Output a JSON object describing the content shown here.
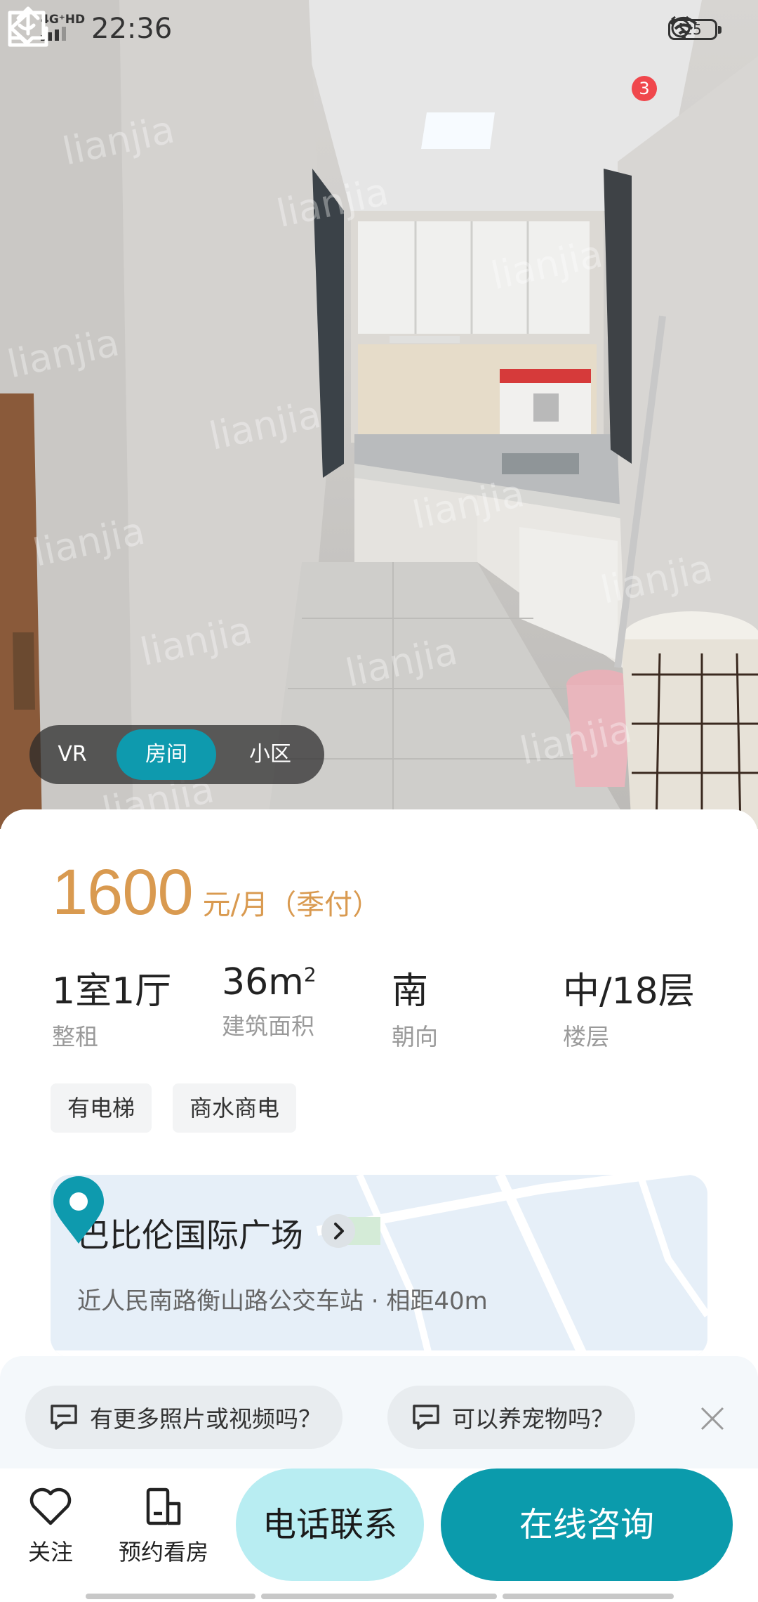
{
  "status_bar": {
    "network": "4G⁺HD",
    "time": "22:36",
    "battery": "25"
  },
  "header": {
    "message_badge": "3"
  },
  "photo": {
    "watermark": "lianjia.com 链家"
  },
  "media_tabs": [
    {
      "label": "VR",
      "active": false
    },
    {
      "label": "房间",
      "active": true
    },
    {
      "label": "小区",
      "active": false
    }
  ],
  "listing": {
    "price": "1600",
    "price_unit": "元/月（季付）",
    "specs": [
      {
        "value": "1室1厅",
        "label": "整租"
      },
      {
        "value": "36m",
        "sup": "2",
        "label": "建筑面积"
      },
      {
        "value": "南",
        "label": "朝向"
      },
      {
        "value": "中/18层",
        "label": "楼层"
      }
    ],
    "tags": [
      "有电梯",
      "商水商电"
    ]
  },
  "community": {
    "name": "巴比伦国际广场",
    "transit": "近人民南路衡山路公交车站 · 相距40m"
  },
  "quick_questions": [
    "有更多照片或视频吗？",
    "可以养宠物吗？"
  ],
  "actions": {
    "follow_label": "关注",
    "book_label": "预约看房",
    "call_label": "电话联系",
    "chat_label": "在线咨询"
  },
  "colors": {
    "accent": "#0b9bac",
    "price": "#d99a50",
    "badge": "#f0474c"
  }
}
